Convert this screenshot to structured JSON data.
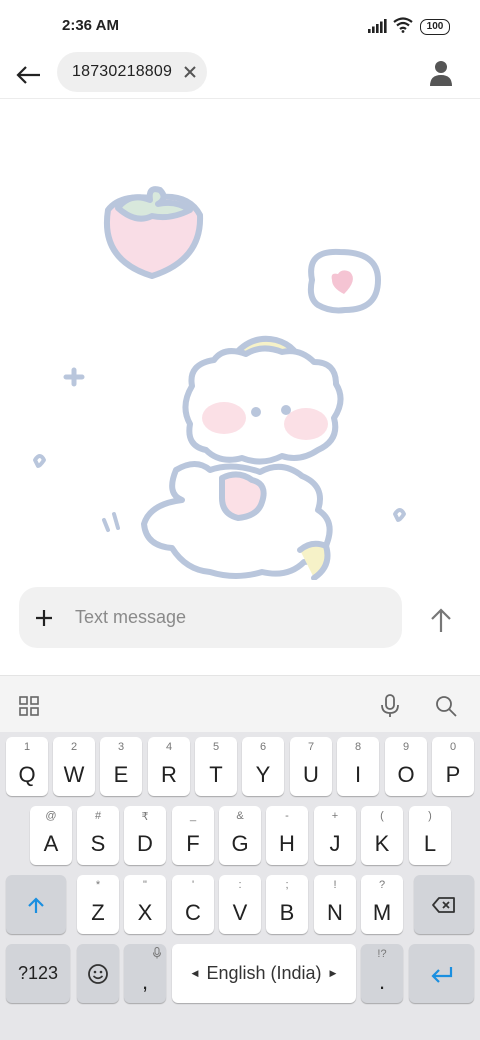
{
  "status_bar": {
    "time": "2:36 AM",
    "battery": "100"
  },
  "header": {
    "recipient": "18730218809"
  },
  "compose": {
    "placeholder": "Text message"
  },
  "keyboard": {
    "row1": [
      {
        "hint": "1",
        "label": "Q"
      },
      {
        "hint": "2",
        "label": "W"
      },
      {
        "hint": "3",
        "label": "E"
      },
      {
        "hint": "4",
        "label": "R"
      },
      {
        "hint": "5",
        "label": "T"
      },
      {
        "hint": "6",
        "label": "Y"
      },
      {
        "hint": "7",
        "label": "U"
      },
      {
        "hint": "8",
        "label": "I"
      },
      {
        "hint": "9",
        "label": "O"
      },
      {
        "hint": "0",
        "label": "P"
      }
    ],
    "row2": [
      {
        "hint": "@",
        "label": "A"
      },
      {
        "hint": "#",
        "label": "S"
      },
      {
        "hint": "₹",
        "label": "D"
      },
      {
        "hint": "_",
        "label": "F"
      },
      {
        "hint": "&",
        "label": "G"
      },
      {
        "hint": "-",
        "label": "H"
      },
      {
        "hint": "+",
        "label": "J"
      },
      {
        "hint": "(",
        "label": "K"
      },
      {
        "hint": ")",
        "label": "L"
      }
    ],
    "row3": [
      {
        "hint": "*",
        "label": "Z"
      },
      {
        "hint": "\"",
        "label": "X"
      },
      {
        "hint": "'",
        "label": "C"
      },
      {
        "hint": ":",
        "label": "V"
      },
      {
        "hint": ";",
        "label": "B"
      },
      {
        "hint": "!",
        "label": "N"
      },
      {
        "hint": "?",
        "label": "M"
      }
    ],
    "symbols_label": "?123",
    "comma_label": ",",
    "period_label": ".",
    "period_hint": "!?",
    "space_label": "English (India)",
    "accent_color": "#1a8fe0"
  }
}
